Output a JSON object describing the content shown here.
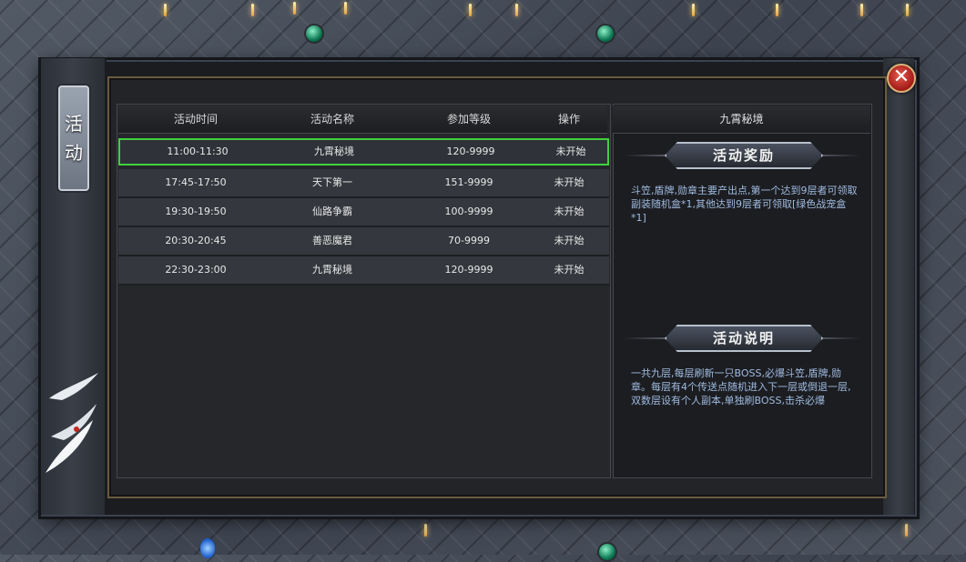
{
  "window": {
    "side_title": [
      "活",
      "动"
    ],
    "close_symbol": "✕"
  },
  "table": {
    "headers": [
      "活动时间",
      "活动名称",
      "参加等级",
      "操作"
    ],
    "rows": [
      {
        "time": "11:00-11:30",
        "name": "九霄秘境",
        "level": "120-9999",
        "status": "未开始",
        "selected": true
      },
      {
        "time": "17:45-17:50",
        "name": "天下第一",
        "level": "151-9999",
        "status": "未开始",
        "selected": false
      },
      {
        "time": "19:30-19:50",
        "name": "仙路争霸",
        "level": "100-9999",
        "status": "未开始",
        "selected": false
      },
      {
        "time": "20:30-20:45",
        "name": "善恶魔君",
        "level": "70-9999",
        "status": "未开始",
        "selected": false
      },
      {
        "time": "22:30-23:00",
        "name": "九霄秘境",
        "level": "120-9999",
        "status": "未开始",
        "selected": false
      }
    ]
  },
  "detail": {
    "title": "九霄秘境",
    "reward_heading": "活动奖励",
    "reward_text": "斗笠,盾牌,勋章主要产出点,第一个达到9层者可领取副装随机盒*1,其他达到9层者可领取[绿色战宠盒*1]",
    "info_heading": "活动说明",
    "info_text": "一共九层,每层刷新一只BOSS,必爆斗笠,盾牌,勋章。每层有4个传送点随机进入下一层或倒退一层,双数层设有个人副本,单独刷BOSS,击杀必爆"
  },
  "colors": {
    "selected_border": "#3fd13f",
    "description_text": "#9fbbe0",
    "close_button": "#c0261d"
  }
}
